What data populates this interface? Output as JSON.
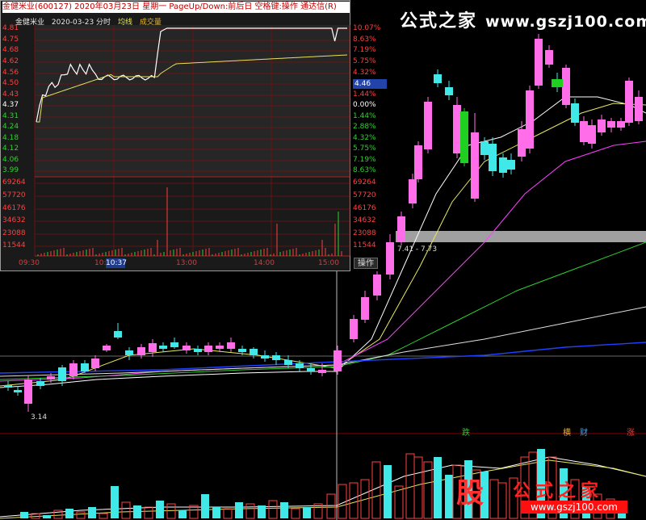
{
  "popup": {
    "header": "金健米业(600127) 2020年03月23日 星期一 PageUp/Down:前后日 空格键:操作 通达信(R)",
    "stock_name": "金健米业",
    "date": "2020-03-23 分时",
    "avg_line": "均线",
    "volume": "成交量",
    "price_labels": [
      "4.81",
      "4.75",
      "4.68",
      "4.62",
      "4.56",
      "4.50",
      "4.43",
      "4.37",
      "4.31",
      "4.24",
      "4.18",
      "4.12",
      "4.06",
      "3.99"
    ],
    "pct_labels": [
      "10.07%",
      "8.63%",
      "7.19%",
      "5.75%",
      "4.32%",
      "",
      "1.44%",
      "0.00%",
      "1.44%",
      "2.88%",
      "4.32%",
      "5.75%",
      "7.19%",
      "8.63%"
    ],
    "current_price_tag": "4.46",
    "vol_labels": [
      "69264",
      "57720",
      "46176",
      "34632",
      "23088",
      "11544"
    ],
    "times": [
      "09:30",
      "10:",
      "13:00",
      "14:00",
      "15:00"
    ],
    "time_highlight": "10:37",
    "operate_button": "操作"
  },
  "watermark_top": {
    "name": "公式之家",
    "url": "www.gszj100.com"
  },
  "logo": {
    "badge": "股",
    "name": "公式之家",
    "url": "www.gszj100.com"
  },
  "chart": {
    "low_label": "3.14",
    "band_label": "7.41 - 7.73",
    "markers": [
      {
        "text": "跌",
        "color": "#30c030"
      },
      {
        "text": "横",
        "color": "#e8b030"
      },
      {
        "text": "财",
        "color": "#4aa0e0"
      },
      {
        "text": "涨",
        "color": "#e04040"
      }
    ]
  },
  "colors": {
    "up": "#ff6ee8",
    "down": "#40e8e8",
    "bear_big": "#20d020",
    "grid": "#8b0000"
  }
}
